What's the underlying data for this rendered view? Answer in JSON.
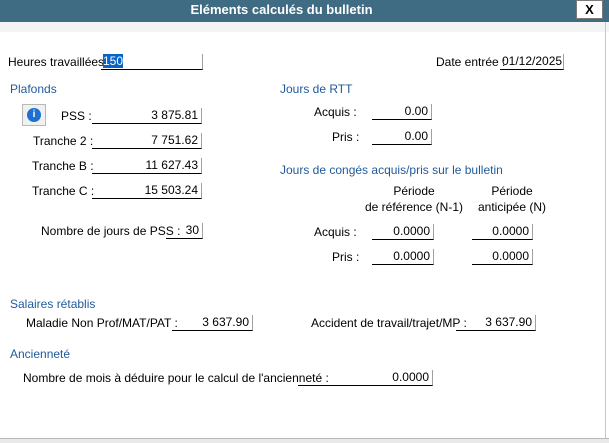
{
  "window": {
    "title": "Eléments calculés du bulletin",
    "close_label": "X"
  },
  "heures": {
    "label": "Heures travaillées :",
    "value": "150"
  },
  "date_entree": {
    "label": "Date entrée :",
    "value": "01/12/2025"
  },
  "plafonds": {
    "title": "Plafonds",
    "pss_label": "PSS :",
    "pss_value": "3 875.81",
    "tranche2_label": "Tranche 2 :",
    "tranche2_value": "7 751.62",
    "trancheB_label": "Tranche B :",
    "trancheB_value": "11 627.43",
    "trancheC_label": "Tranche C :",
    "trancheC_value": "15 503.24",
    "nb_jours_label": "Nombre de jours de PSS :",
    "nb_jours_value": "30"
  },
  "rtt": {
    "title": "Jours de RTT",
    "acquis_label": "Acquis :",
    "acquis_value": "0.00",
    "pris_label": "Pris :",
    "pris_value": "0.00"
  },
  "conges": {
    "title": "Jours de congés acquis/pris sur le bulletin",
    "col1_line1": "Période",
    "col1_line2": "de référence (N-1)",
    "col2_line1": "Période",
    "col2_line2": "anticipée (N)",
    "acquis_label": "Acquis :",
    "acquis_ref": "0.0000",
    "acquis_ant": "0.0000",
    "pris_label": "Pris :",
    "pris_ref": "0.0000",
    "pris_ant": "0.0000"
  },
  "salaires": {
    "title": "Salaires rétablis",
    "maladie_label": "Maladie Non Prof/MAT/PAT :",
    "maladie_value": "3 637.90",
    "accident_label": "Accident de travail/trajet/MP :",
    "accident_value": "3 637.90"
  },
  "anciennete": {
    "title": "Ancienneté",
    "mois_label": "Nombre de mois à déduire pour le calcul de l'ancienneté :",
    "mois_value": "0.0000"
  },
  "icons": {
    "info": "info-icon"
  },
  "colors": {
    "titlebar": "#3f6b83",
    "section_title": "#1f5a9c",
    "selection": "#0a64c8"
  }
}
